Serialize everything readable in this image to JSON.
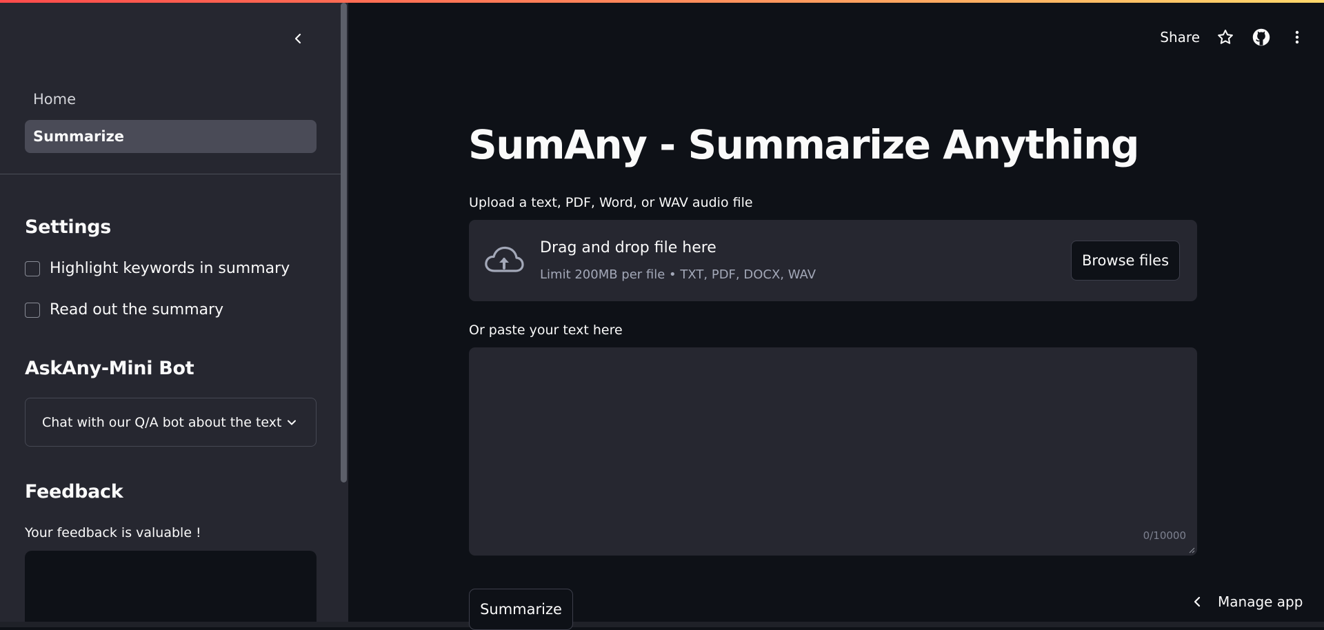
{
  "header": {
    "share_label": "Share",
    "icons": [
      "star-icon",
      "github-icon",
      "more-vertical-icon"
    ]
  },
  "sidebar": {
    "nav": [
      {
        "label": "Home",
        "active": false
      },
      {
        "label": "Summarize",
        "active": true
      }
    ],
    "settings": {
      "title": "Settings",
      "options": [
        {
          "label": "Highlight keywords in summary",
          "checked": false
        },
        {
          "label": "Read out the summary",
          "checked": false
        }
      ]
    },
    "bot": {
      "title": "AskAny-Mini Bot",
      "expander_label": "Chat with our Q/A bot about the text"
    },
    "feedback": {
      "title": "Feedback",
      "prompt": "Your feedback is valuable !",
      "value": ""
    }
  },
  "main": {
    "title": "SumAny - Summarize Anything",
    "upload": {
      "label": "Upload a text, PDF, Word, or WAV audio file",
      "drop_text": "Drag and drop file here",
      "limit_text": "Limit 200MB per file • TXT, PDF, DOCX, WAV",
      "browse_label": "Browse files"
    },
    "paste": {
      "label": "Or paste your text here",
      "value": "",
      "counter": "0/10000"
    },
    "summarize_label": "Summarize"
  },
  "footer": {
    "manage_label": "Manage app"
  },
  "colors": {
    "background": "#0e1117",
    "sidebar": "#262730",
    "accent_gradient": [
      "#ff4b4b",
      "#ffd86b"
    ]
  }
}
